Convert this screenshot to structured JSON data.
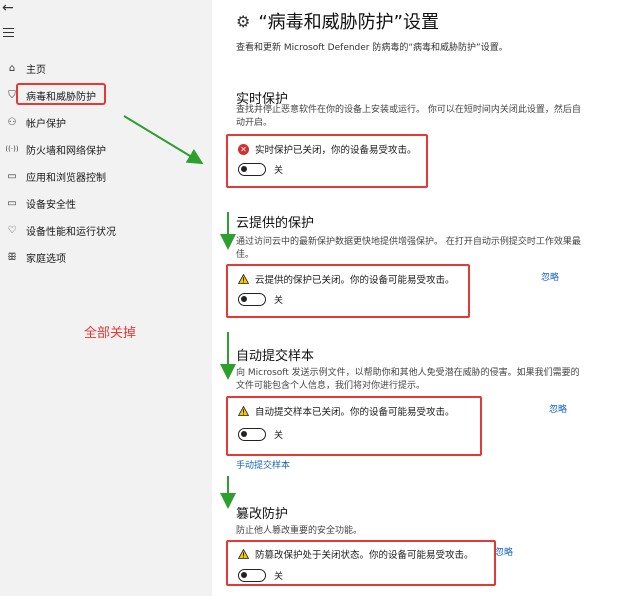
{
  "sidebar": {
    "items": [
      {
        "label": "主页",
        "icon": "home-icon",
        "glyph": "⌂"
      },
      {
        "label": "病毒和威胁防护",
        "icon": "shield-icon",
        "glyph": "⛉"
      },
      {
        "label": "帐户保护",
        "icon": "person-icon",
        "glyph": "⚇"
      },
      {
        "label": "防火墙和网络保护",
        "icon": "wifi-icon",
        "glyph": "((·))"
      },
      {
        "label": "应用和浏览器控制",
        "icon": "app-window-icon",
        "glyph": "▭"
      },
      {
        "label": "设备安全性",
        "icon": "laptop-icon",
        "glyph": "▭"
      },
      {
        "label": "设备性能和运行状况",
        "icon": "heart-icon",
        "glyph": "♡"
      },
      {
        "label": "家庭选项",
        "icon": "family-icon",
        "glyph": "ꕥ"
      }
    ],
    "annotation": "全部关掉"
  },
  "main": {
    "title": "“病毒和威胁防护”设置",
    "subtitle": "查看和更新 Microsoft Defender 防病毒的“病毒和威胁防护”设置。",
    "sections": [
      {
        "title": "实时保护",
        "desc": "查找并停止恶意软件在你的设备上安装或运行。 你可以在短时间内关闭此设置，然后自动开启。",
        "status": "实时保护已关闭，你的设备易受攻击。",
        "toggle": "关"
      },
      {
        "title": "云提供的保护",
        "desc": "通过访问云中的最新保护数据更快地提供增强保护。 在打开自动示例提交时工作效果最佳。",
        "status": "云提供的保护已关闭。你的设备可能易受攻击。",
        "toggle": "关",
        "dismiss": "忽略"
      },
      {
        "title": "自动提交样本",
        "desc": "向 Microsoft 发送示例文件，以帮助你和其他人免受潜在威胁的侵害。如果我们需要的文件可能包含个人信息，我们将对你进行提示。",
        "status": "自动提交样本已关闭。你的设备可能易受攻击。",
        "toggle": "关",
        "dismiss": "忽略",
        "link": "手动提交样本"
      },
      {
        "title": "篡改防护",
        "desc": "防止他人篡改重要的安全功能。",
        "status": "防篡改保护处于关闭状态。你的设备可能易受攻击。",
        "toggle": "关",
        "dismiss": "忽略"
      }
    ]
  },
  "colors": {
    "highlight": "#e53935",
    "arrow": "#2e9e2e",
    "link": "#1565c0",
    "sidebar_bg": "#f2f2f2"
  }
}
